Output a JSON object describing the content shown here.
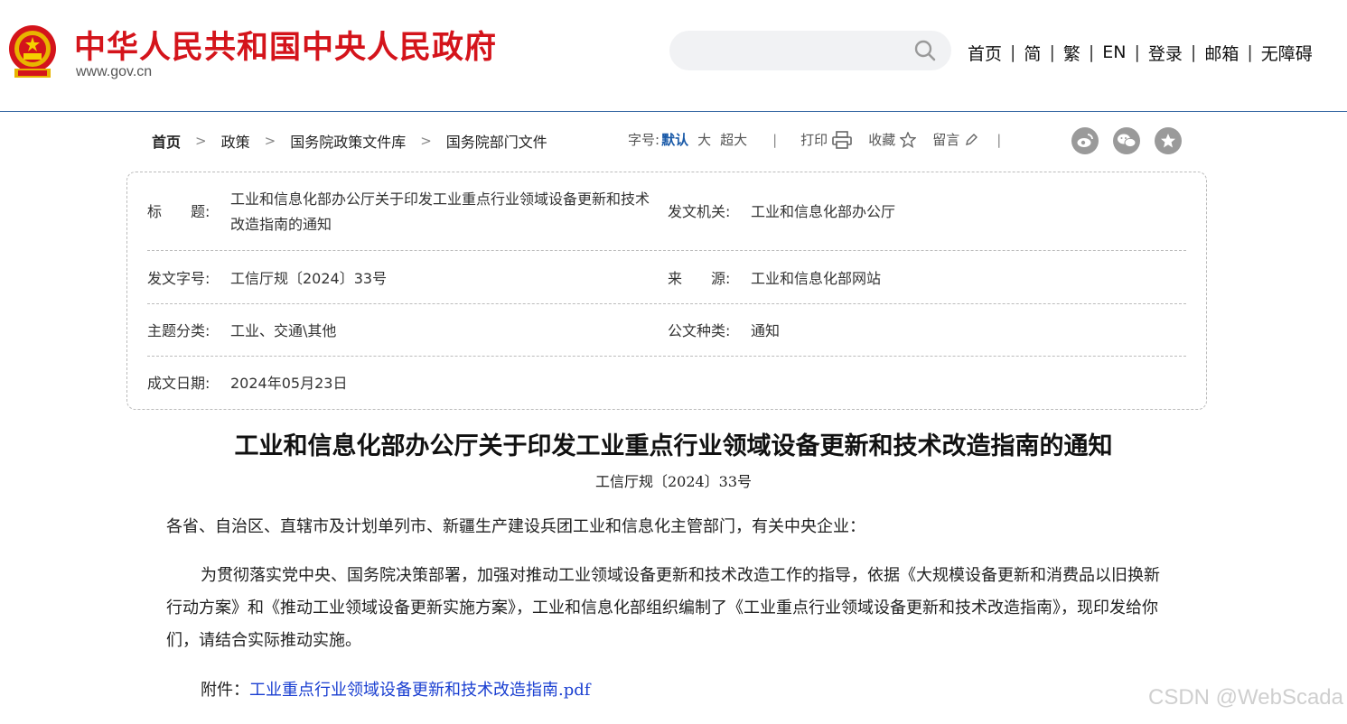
{
  "header": {
    "site_title": "中华人民共和国中央人民政府",
    "site_domain": "www.gov.cn",
    "search_placeholder": "",
    "nav": [
      "首页",
      "简",
      "繁",
      "EN",
      "登录",
      "邮箱",
      "无障碍"
    ]
  },
  "breadcrumb": [
    "首页",
    "政策",
    "国务院政策文件库",
    "国务院部门文件"
  ],
  "tools": {
    "font_label": "字号:",
    "font_sizes": [
      "默认",
      "大",
      "超大"
    ],
    "print": "打印",
    "favorite": "收藏",
    "comment": "留言"
  },
  "info": {
    "title_label": "标　　题:",
    "title_value": "工业和信息化部办公厅关于印发工业重点行业领域设备更新和技术改造指南的通知",
    "issuer_label": "发文机关:",
    "issuer_value": "工业和信息化部办公厅",
    "docno_label": "发文字号:",
    "docno_value": "工信厅规〔2024〕33号",
    "source_label": "来　　源:",
    "source_value": "工业和信息化部网站",
    "category_label": "主题分类:",
    "category_value": "工业、交通\\其他",
    "doctype_label": "公文种类:",
    "doctype_value": "通知",
    "date_label": "成文日期:",
    "date_value": "2024年05月23日"
  },
  "article": {
    "title": "工业和信息化部办公厅关于印发工业重点行业领域设备更新和技术改造指南的通知",
    "docno": "工信厅规〔2024〕33号",
    "salutation": "各省、自治区、直辖市及计划单列市、新疆生产建设兵团工业和信息化主管部门，有关中央企业：",
    "body": "为贯彻落实党中央、国务院决策部署，加强对推动工业领域设备更新和技术改造工作的指导，依据《大规模设备更新和消费品以旧换新行动方案》和《推动工业领域设备更新实施方案》，工业和信息化部组织编制了《工业重点行业领域设备更新和技术改造指南》，现印发给你们，请结合实际推动实施。",
    "attachment_label": "附件：",
    "attachment_link": "工业重点行业领域设备更新和技术改造指南.pdf"
  },
  "watermark": "CSDN @WebScada",
  "colors": {
    "brand_red": "#d4141b",
    "link_blue": "#1a3fd1",
    "accent_blue": "#1a5aa8"
  }
}
